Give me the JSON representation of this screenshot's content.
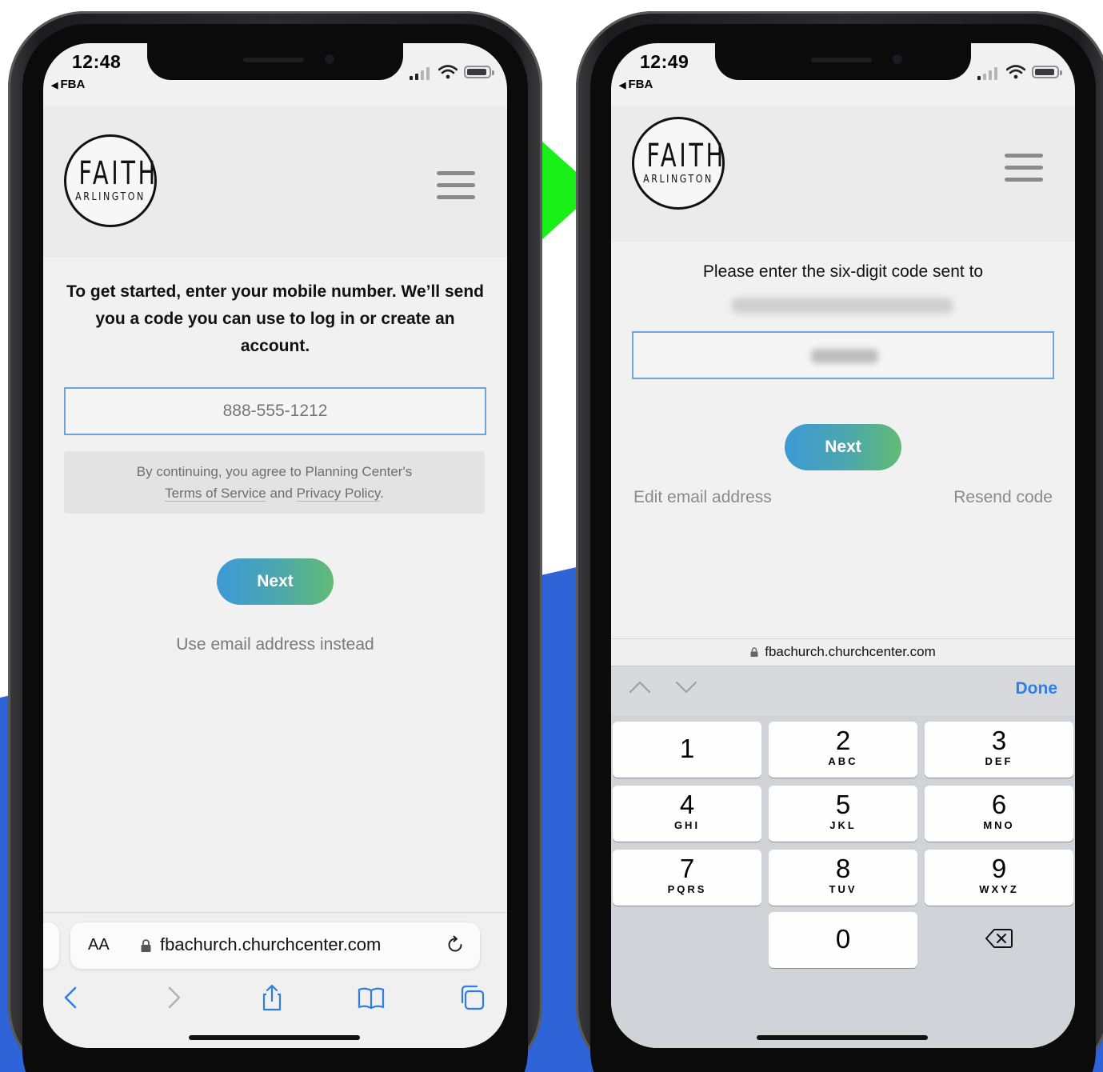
{
  "colors": {
    "brand_blue": "#2f63d8",
    "arrow_green": "#18f018",
    "input_border": "#6da4dd",
    "link_blue": "#2d7ee6",
    "next_gradient_start": "#3d9ad6",
    "next_gradient_end": "#62bb74"
  },
  "left_phone": {
    "status": {
      "time": "12:48",
      "back_app": "FBA"
    },
    "logo": {
      "line1": "FAITH",
      "line2": "ARLINGTON"
    },
    "intro_text": "To get started, enter your mobile number. We’ll send you a code you can use to log in or create an account.",
    "phone_input": {
      "placeholder": "888-555-1212",
      "value": ""
    },
    "terms": {
      "prefix": "By continuing, you agree to Planning Center's",
      "terms_link": "Terms of Service",
      "conjunction": "and",
      "privacy_link": "Privacy Policy",
      "suffix": "."
    },
    "next_label": "Next",
    "use_email_label": "Use email address instead",
    "safari": {
      "aa_label": "AA",
      "url": "fbachurch.churchcenter.com",
      "toolbar_icons": [
        "back-icon",
        "forward-icon",
        "share-icon",
        "bookmarks-icon",
        "tabs-icon"
      ]
    }
  },
  "right_phone": {
    "status": {
      "time": "12:49",
      "back_app": "FBA"
    },
    "logo": {
      "line1": "FAITH",
      "line2": "ARLINGTON"
    },
    "prompt_text": "Please enter the six-digit code sent to",
    "next_label": "Next",
    "edit_email_label": "Edit email address",
    "resend_label": "Resend code",
    "url": "fbachurch.churchcenter.com",
    "done_label": "Done",
    "keypad": [
      {
        "num": "1",
        "letters": ""
      },
      {
        "num": "2",
        "letters": "ABC"
      },
      {
        "num": "3",
        "letters": "DEF"
      },
      {
        "num": "4",
        "letters": "GHI"
      },
      {
        "num": "5",
        "letters": "JKL"
      },
      {
        "num": "6",
        "letters": "MNO"
      },
      {
        "num": "7",
        "letters": "PQRS"
      },
      {
        "num": "8",
        "letters": "TUV"
      },
      {
        "num": "9",
        "letters": "WXYZ"
      },
      {
        "num": "0",
        "letters": ""
      }
    ]
  }
}
